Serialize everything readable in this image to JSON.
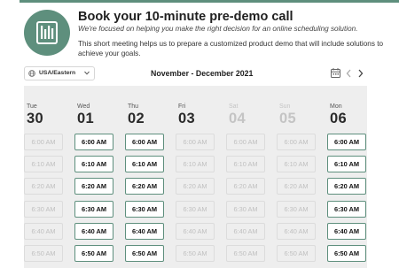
{
  "header": {
    "title": "Book your 10-minute pre-demo call",
    "subtitle": "We're focused on helping you make the right decision for an online scheduling solution.",
    "description": "This short meeting helps us to prepare a customized product demo that will include solutions to achieve your goals."
  },
  "toolbar": {
    "timezone": "USA/Eastern",
    "month_range": "November - December 2021"
  },
  "days": [
    {
      "dow": "Tue",
      "date": "30",
      "available": false
    },
    {
      "dow": "Wed",
      "date": "01",
      "available": true
    },
    {
      "dow": "Thu",
      "date": "02",
      "available": true
    },
    {
      "dow": "Fri",
      "date": "03",
      "available": false
    },
    {
      "dow": "Sat",
      "date": "04",
      "available": false,
      "disabled": true
    },
    {
      "dow": "Sun",
      "date": "05",
      "available": false,
      "disabled": true
    },
    {
      "dow": "Mon",
      "date": "06",
      "available": true
    }
  ],
  "times": [
    "6:00 AM",
    "6:10 AM",
    "6:20 AM",
    "6:30 AM",
    "6:40 AM",
    "6:50 AM"
  ],
  "colors": {
    "accent": "#5e8f7d",
    "panel": "#eeeeee"
  }
}
